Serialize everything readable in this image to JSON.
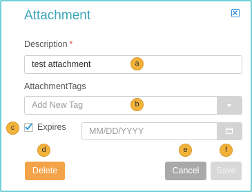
{
  "dialog": {
    "title": "Attachment",
    "close_icon": "close-icon"
  },
  "description": {
    "label": "Description",
    "required_mark": "*",
    "value": "test attachment"
  },
  "tags": {
    "label": "AttachmentTags",
    "placeholder": "Add New Tag",
    "dropdown_icon": "chevron-down-icon"
  },
  "expires": {
    "label": "Expires",
    "checked": true,
    "date_placeholder": "MM/DD/YYYY",
    "calendar_icon": "calendar-icon"
  },
  "buttons": {
    "delete": "Delete",
    "cancel": "Cancel",
    "save": "Save"
  },
  "callouts": [
    "a",
    "b",
    "c",
    "d",
    "e",
    "f"
  ],
  "colors": {
    "title": "#3aa6b8",
    "frame": "#6fd0d6",
    "callout": "#f3b23a",
    "delete": "#f4a349",
    "cancel": "#a9a9a9",
    "save": "#d8d8d8",
    "checkmark": "#2a9fd6",
    "required": "#e74c3c"
  }
}
